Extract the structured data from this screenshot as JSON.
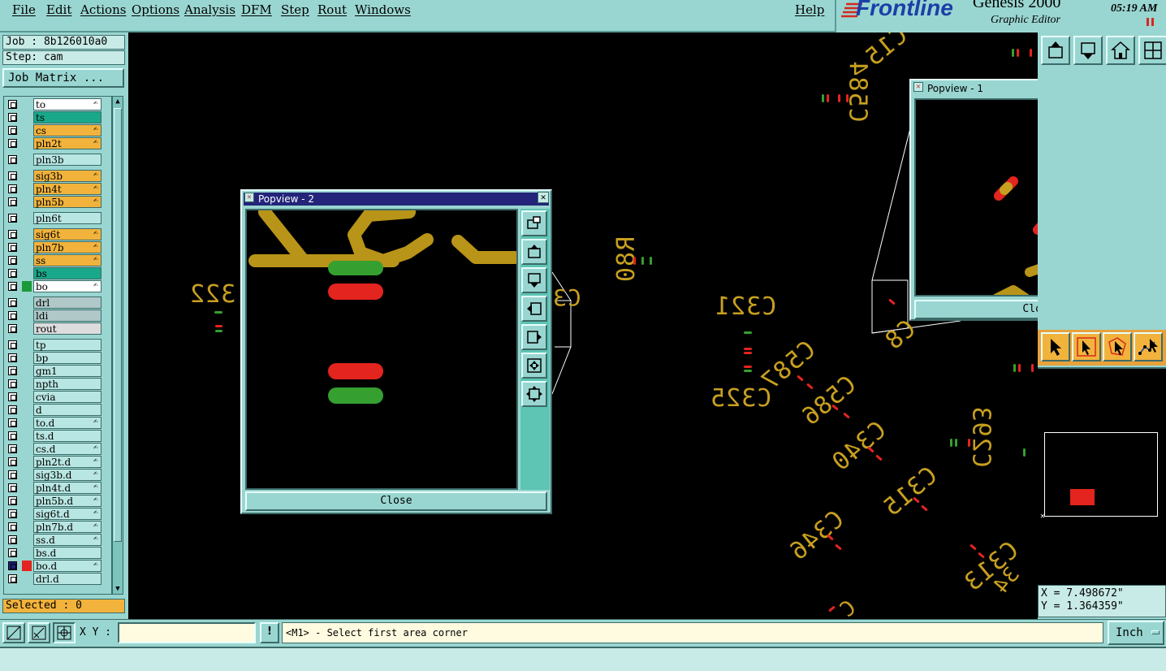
{
  "menu": {
    "items": [
      "File",
      "Edit",
      "Actions",
      "Options",
      "Analysis",
      "DFM",
      "Step",
      "Rout",
      "Windows"
    ],
    "help": "Help"
  },
  "brand": {
    "logo": "Frontline",
    "product": "Genesis 2000",
    "subtitle": "Graphic Editor",
    "time": "05:19 AM"
  },
  "job": {
    "job_label": "Job : 8b126010a0",
    "step_label": "Step: cam",
    "matrix_button": "Job Matrix ..."
  },
  "layers": [
    {
      "name": "to",
      "bg": "#ffffff",
      "edit": true
    },
    {
      "name": "ts",
      "bg": "#1aa88a",
      "edit": false
    },
    {
      "name": "cs",
      "bg": "#f2b33c",
      "edit": true
    },
    {
      "name": "pln2t",
      "bg": "#f2b33c",
      "edit": true
    },
    {
      "name": "pln3b",
      "bg": "#b8e6e2",
      "edit": false
    },
    {
      "name": "sig3b",
      "bg": "#f2b33c",
      "edit": true
    },
    {
      "name": "pln4t",
      "bg": "#f2b33c",
      "edit": true
    },
    {
      "name": "pln5b",
      "bg": "#f2b33c",
      "edit": true
    },
    {
      "name": "pln6t",
      "bg": "#b8e6e2",
      "edit": false
    },
    {
      "name": "sig6t",
      "bg": "#f2b33c",
      "edit": true
    },
    {
      "name": "pln7b",
      "bg": "#f2b33c",
      "edit": true
    },
    {
      "name": "ss",
      "bg": "#f2b33c",
      "edit": true
    },
    {
      "name": "bs",
      "bg": "#1aa88a",
      "edit": false
    },
    {
      "name": "bo",
      "bg": "#ffffff",
      "edit": true,
      "swatch": "#1a9a3a"
    },
    {
      "name": "drl",
      "bg": "#b0c8c8",
      "edit": false
    },
    {
      "name": "ldi",
      "bg": "#b0c8c8",
      "edit": false
    },
    {
      "name": "rout",
      "bg": "#dcdcdc",
      "edit": false
    },
    {
      "name": "tp",
      "bg": "#b8e6e2",
      "edit": false
    },
    {
      "name": "bp",
      "bg": "#b8e6e2",
      "edit": false
    },
    {
      "name": "gm1",
      "bg": "#b8e6e2",
      "edit": false
    },
    {
      "name": "npth",
      "bg": "#b8e6e2",
      "edit": false
    },
    {
      "name": "cvia",
      "bg": "#b8e6e2",
      "edit": false
    },
    {
      "name": "d",
      "bg": "#b8e6e2",
      "edit": false
    },
    {
      "name": "to.d",
      "bg": "#b8e6e2",
      "edit": true
    },
    {
      "name": "ts.d",
      "bg": "#b8e6e2",
      "edit": false
    },
    {
      "name": "cs.d",
      "bg": "#b8e6e2",
      "edit": true
    },
    {
      "name": "pln2t.d",
      "bg": "#b8e6e2",
      "edit": true
    },
    {
      "name": "sig3b.d",
      "bg": "#b8e6e2",
      "edit": true
    },
    {
      "name": "pln4t.d",
      "bg": "#b8e6e2",
      "edit": true
    },
    {
      "name": "pln5b.d",
      "bg": "#b8e6e2",
      "edit": true
    },
    {
      "name": "sig6t.d",
      "bg": "#b8e6e2",
      "edit": true
    },
    {
      "name": "pln7b.d",
      "bg": "#b8e6e2",
      "edit": true
    },
    {
      "name": "ss.d",
      "bg": "#b8e6e2",
      "edit": true
    },
    {
      "name": "bs.d",
      "bg": "#b8e6e2",
      "edit": false
    },
    {
      "name": "bo.d",
      "bg": "#b8e6e2",
      "edit": true,
      "swatch": "#e3241f",
      "selected": true
    },
    {
      "name": "drl.d",
      "bg": "#b8e6e2",
      "edit": false
    }
  ],
  "selected_label": "Selected : 0",
  "canvas_labels": [
    "322",
    "C3",
    "R80",
    "C321",
    "C325",
    "C587",
    "C586",
    "C340",
    "C293",
    "C315",
    "C346",
    "C313",
    "34",
    "C584",
    "C15",
    "C8",
    "C"
  ],
  "popview2": {
    "title": "Popview - 2",
    "close": "Close"
  },
  "popview1": {
    "title": "Popview - 1",
    "close": "Close"
  },
  "coords": {
    "x": "X = 7.498672\"",
    "y": "Y = 1.364359\""
  },
  "bottom": {
    "xy_label": "X Y :",
    "xy_value": "",
    "prompt": "<M1> - Select first area corner",
    "units": "Inch",
    "warn_icon": "!"
  },
  "colors": {
    "panel": "#9ad6d1",
    "pad_red": "#e3241f",
    "pad_green": "#35a030",
    "silk": "#c8a020",
    "title_bar": "#23247a"
  }
}
